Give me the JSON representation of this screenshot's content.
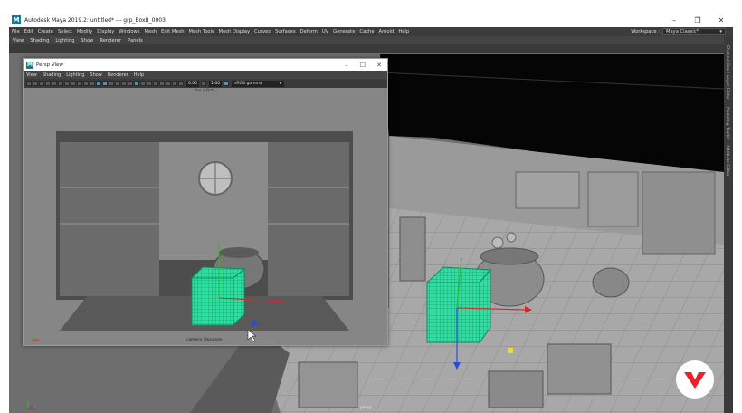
{
  "app": {
    "title": "Autodesk Maya 2019.2: untitled*   ---   grp_BoxB_0003",
    "logo_letter": "M",
    "minimize": "–",
    "maximize": "❐",
    "close": "✕"
  },
  "menubar": {
    "items": [
      "File",
      "Edit",
      "Create",
      "Select",
      "Modify",
      "Display",
      "Windows",
      "Mesh",
      "Edit Mesh",
      "Mesh Tools",
      "Mesh Display",
      "Curves",
      "Surfaces",
      "Deform",
      "UV",
      "Generate",
      "Cache",
      "Arnold",
      "Help"
    ],
    "workspace_label": "Workspace :",
    "workspace_value": "Maya Classic*"
  },
  "viewport": {
    "menu": [
      "View",
      "Shading",
      "Lighting",
      "Show",
      "Renderer",
      "Panels"
    ],
    "camera_label": "persp"
  },
  "right_tabs": [
    "Channel Box / Layer Editor",
    "Modeling Toolkit",
    "Attribute Editor"
  ],
  "persp_window": {
    "title": "Persp View",
    "menu": [
      "View",
      "Shading",
      "Lighting",
      "Show",
      "Renderer",
      "Help"
    ],
    "near_value": "0.00",
    "far_value": "1.00",
    "color_space": "sRGB gamma",
    "hud_title": "Iso a Bot",
    "camera_label": "camera_Dungeon"
  },
  "brand": {
    "accent": "#e8212b"
  },
  "colors": {
    "selection_green": "#2de0a0",
    "viewport_bg": "#6b6b6b",
    "maya_teal": "#117e8e"
  }
}
